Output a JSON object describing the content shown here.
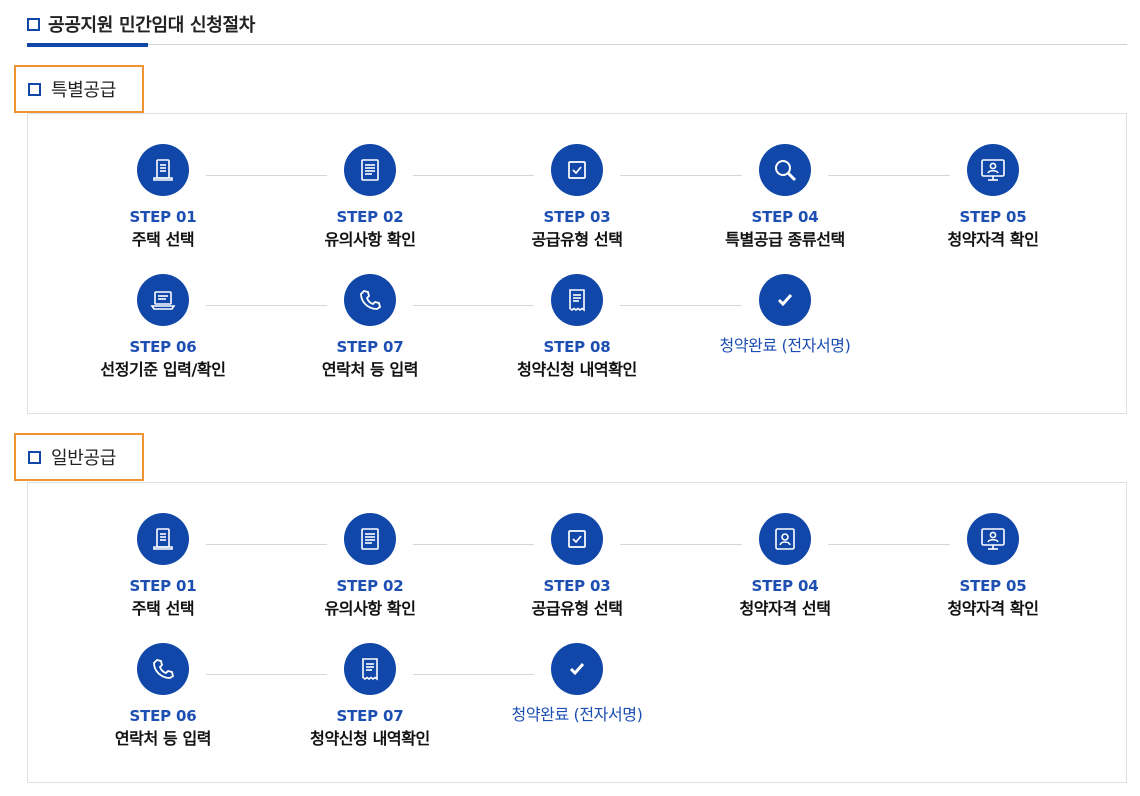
{
  "page_title": "공공지원 민간임대 신청절차",
  "sections": [
    {
      "heading": "특별공급",
      "rows": [
        [
          {
            "no": "STEP 01",
            "label": "주택 선택",
            "icon": "document-icon"
          },
          {
            "no": "STEP 02",
            "label": "유의사항 확인",
            "icon": "notice-icon"
          },
          {
            "no": "STEP 03",
            "label": "공급유형 선택",
            "icon": "checkbox-icon"
          },
          {
            "no": "STEP 04",
            "label": "특별공급 종류선택",
            "icon": "search-icon"
          },
          {
            "no": "STEP 05",
            "label": "청약자격 확인",
            "icon": "monitor-user-icon"
          }
        ],
        [
          {
            "no": "STEP 06",
            "label": "선정기준 입력/확인",
            "icon": "laptop-icon"
          },
          {
            "no": "STEP 07",
            "label": "연락처 등 입력",
            "icon": "phone-icon"
          },
          {
            "no": "STEP 08",
            "label": "청약신청 내역확인",
            "icon": "receipt-icon"
          },
          {
            "no": "",
            "label": "청약완료 (전자서명)",
            "icon": "checkmark-icon"
          }
        ]
      ]
    },
    {
      "heading": "일반공급",
      "rows": [
        [
          {
            "no": "STEP 01",
            "label": "주택 선택",
            "icon": "document-icon"
          },
          {
            "no": "STEP 02",
            "label": "유의사항 확인",
            "icon": "notice-icon"
          },
          {
            "no": "STEP 03",
            "label": "공급유형 선택",
            "icon": "checkbox-icon"
          },
          {
            "no": "STEP 04",
            "label": "청약자격 선택",
            "icon": "user-card-icon"
          },
          {
            "no": "STEP 05",
            "label": "청약자격 확인",
            "icon": "monitor-user-icon"
          }
        ],
        [
          {
            "no": "STEP 06",
            "label": "연락처 등 입력",
            "icon": "phone-icon"
          },
          {
            "no": "STEP 07",
            "label": "청약신청 내역확인",
            "icon": "receipt-icon"
          },
          {
            "no": "",
            "label": "청약완료 (전자서명)",
            "icon": "checkmark-icon"
          }
        ]
      ]
    }
  ],
  "colors": {
    "accent": "#1147a8",
    "step_text": "#1d4fb3",
    "highlight_border": "#f29333"
  }
}
